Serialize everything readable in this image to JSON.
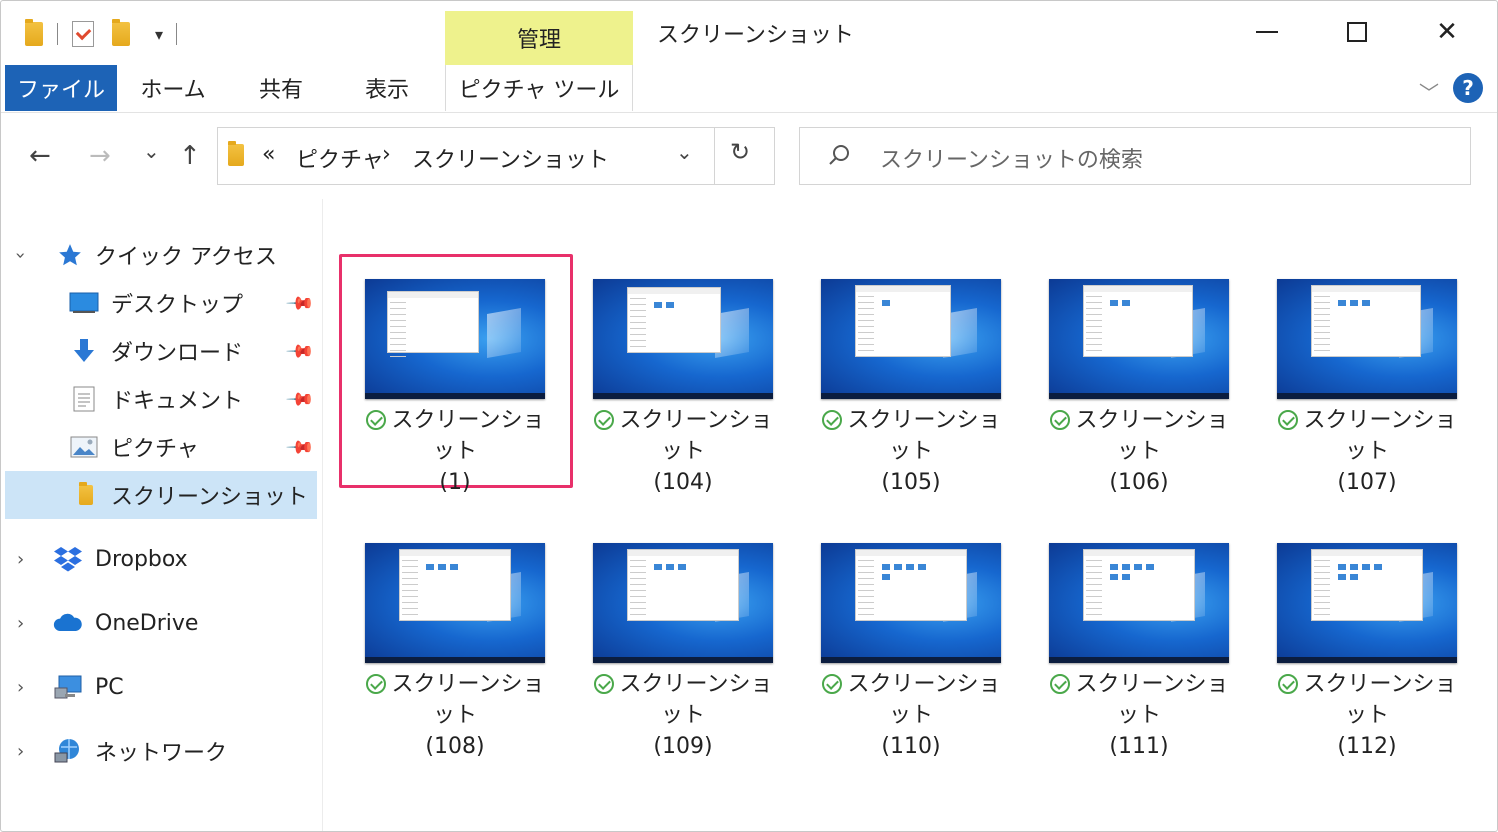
{
  "titlebar": {
    "title": "スクリーンショット",
    "context_tab": "管理",
    "minimize_icon": "minimize-icon",
    "maximize_icon": "maximize-icon",
    "close_glyph": "✕"
  },
  "ribbon": {
    "tabs": [
      "ファイル",
      "ホーム",
      "共有",
      "表示",
      "ピクチャ ツール"
    ],
    "expand_glyph": "﹀",
    "help_glyph": "?"
  },
  "nav": {
    "back": "←",
    "forward": "→",
    "recent": "⌄",
    "up": "↑",
    "address": {
      "overflow": "«",
      "crumbs": [
        "ピクチャ",
        "スクリーンショット"
      ],
      "separator": "›",
      "dropdown": "⌄",
      "refresh": "↻"
    },
    "search_placeholder": "スクリーンショットの検索"
  },
  "sidebar": {
    "quick_access": "クイック アクセス",
    "items": [
      {
        "label": "デスクトップ",
        "icon": "desktop-icon",
        "pinned": true
      },
      {
        "label": "ダウンロード",
        "icon": "download-icon",
        "pinned": true
      },
      {
        "label": "ドキュメント",
        "icon": "documents-icon",
        "pinned": true
      },
      {
        "label": "ピクチャ",
        "icon": "pictures-icon",
        "pinned": true
      },
      {
        "label": "スクリーンショット",
        "icon": "folder-icon",
        "pinned": false,
        "selected": true
      }
    ],
    "roots": [
      {
        "label": "Dropbox",
        "icon": "dropbox-icon"
      },
      {
        "label": "OneDrive",
        "icon": "onedrive-icon"
      },
      {
        "label": "PC",
        "icon": "pc-icon"
      },
      {
        "label": "ネットワーク",
        "icon": "network-icon"
      }
    ]
  },
  "files": [
    {
      "name": "スクリーンショット",
      "num": "(1)",
      "selected": true
    },
    {
      "name": "スクリーンショット",
      "num": "(104)"
    },
    {
      "name": "スクリーンショット",
      "num": "(105)"
    },
    {
      "name": "スクリーンショット",
      "num": "(106)"
    },
    {
      "name": "スクリーンショット",
      "num": "(107)"
    },
    {
      "name": "スクリーンショット",
      "num": "(108)"
    },
    {
      "name": "スクリーンショット",
      "num": "(109)"
    },
    {
      "name": "スクリーンショット",
      "num": "(110)"
    },
    {
      "name": "スクリーンショット",
      "num": "(111)"
    },
    {
      "name": "スクリーンショット",
      "num": "(112)"
    }
  ],
  "colors": {
    "accent": "#1d63b6",
    "context_tab": "#eef28d",
    "selection": "#cce4f7",
    "highlight_box": "#e8306a",
    "sync_ok": "#4aa84a"
  }
}
